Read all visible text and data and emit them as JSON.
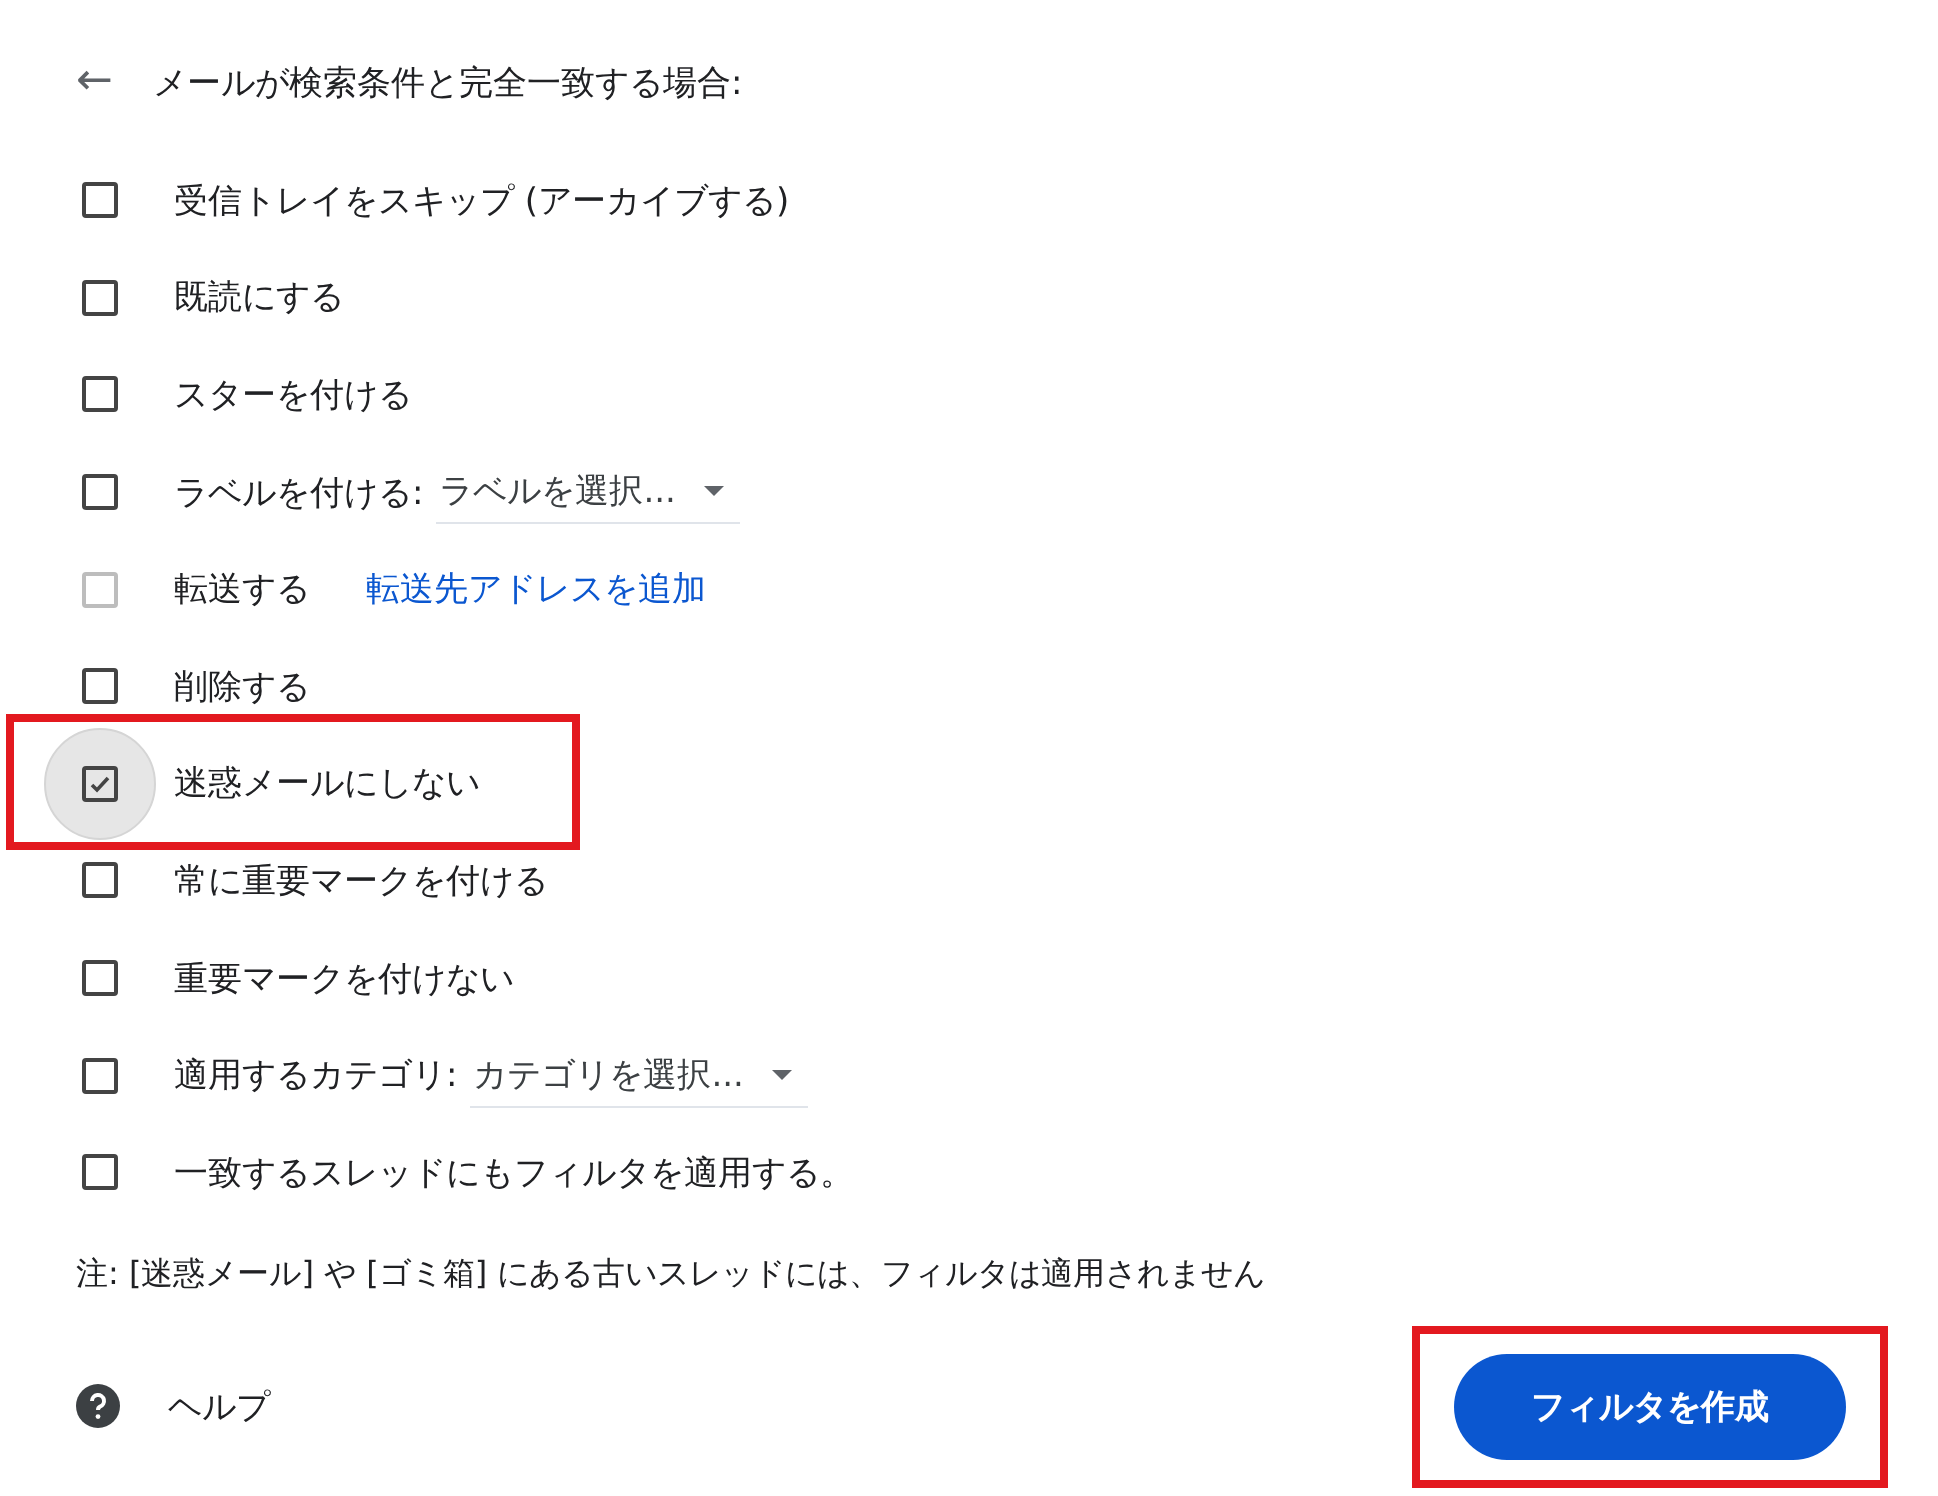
{
  "header": {
    "back_icon": "←",
    "title": "メールが検索条件と完全一致する場合:"
  },
  "actions": [
    {
      "kind": "plain",
      "label": "受信トレイをスキップ (アーカイブする)",
      "checked": false,
      "disabled": false,
      "focused": false,
      "highlighted": false
    },
    {
      "kind": "plain",
      "label": "既読にする",
      "checked": false,
      "disabled": false,
      "focused": false,
      "highlighted": false
    },
    {
      "kind": "plain",
      "label": "スターを付ける",
      "checked": false,
      "disabled": false,
      "focused": false,
      "highlighted": false
    },
    {
      "kind": "select",
      "label": "ラベルを付ける:",
      "select": "ラベルを選択...",
      "checked": false,
      "disabled": false,
      "focused": false,
      "highlighted": false
    },
    {
      "kind": "link",
      "label": "転送する",
      "link": "転送先アドレスを追加",
      "checked": false,
      "disabled": true,
      "focused": false,
      "highlighted": false
    },
    {
      "kind": "plain",
      "label": "削除する",
      "checked": false,
      "disabled": false,
      "focused": false,
      "highlighted": false
    },
    {
      "kind": "plain",
      "label": "迷惑メールにしない",
      "checked": true,
      "disabled": false,
      "focused": true,
      "highlighted": true
    },
    {
      "kind": "plain",
      "label": "常に重要マークを付ける",
      "checked": false,
      "disabled": false,
      "focused": false,
      "highlighted": false
    },
    {
      "kind": "plain",
      "label": "重要マークを付けない",
      "checked": false,
      "disabled": false,
      "focused": false,
      "highlighted": false
    },
    {
      "kind": "select",
      "label": "適用するカテゴリ:",
      "select": "カテゴリを選択...",
      "checked": false,
      "disabled": false,
      "focused": false,
      "highlighted": false
    },
    {
      "kind": "plain",
      "label": "一致するスレッドにもフィルタを適用する。",
      "checked": false,
      "disabled": false,
      "focused": false,
      "highlighted": false
    }
  ],
  "note": "注: [迷惑メール] や [ゴミ箱] にある古いスレッドには、フィルタは適用されません",
  "help": {
    "label": "ヘルプ"
  },
  "create_button": {
    "label": "フィルタを作成",
    "highlighted": true
  }
}
